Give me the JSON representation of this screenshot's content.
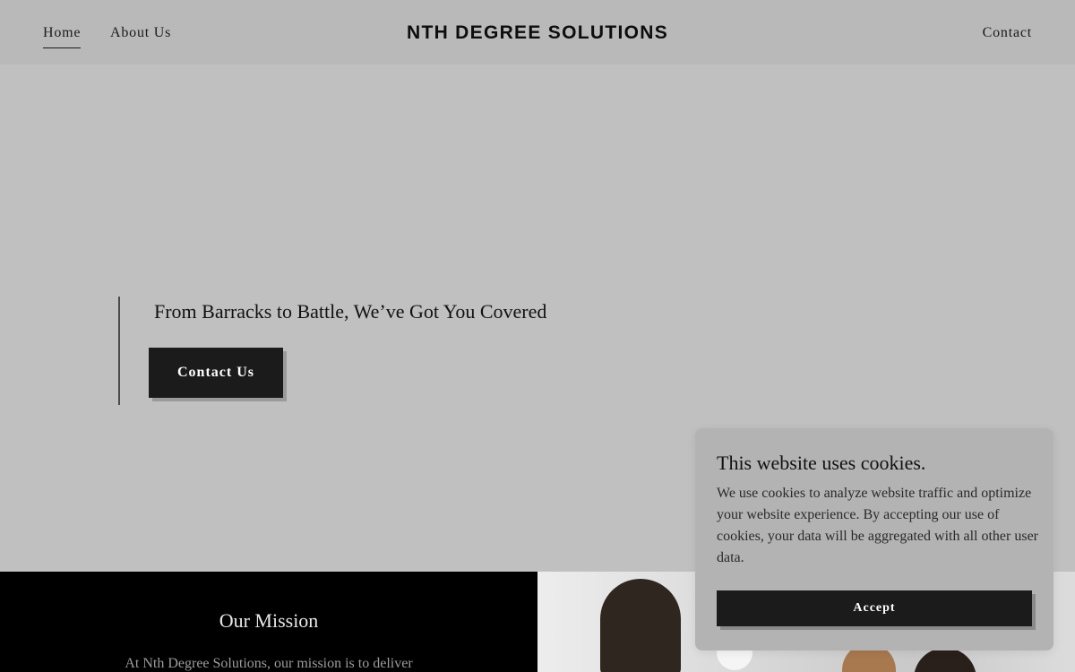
{
  "header": {
    "nav_home": "Home",
    "nav_about": "About Us",
    "brand": "NTH DEGREE SOLUTIONS",
    "nav_contact": "Contact"
  },
  "hero": {
    "tagline": "From Barracks to Battle, We’ve Got You Covered",
    "cta_label": "Contact Us"
  },
  "mission": {
    "title": "Our Mission",
    "text": "At Nth Degree Solutions, our mission is to deliver"
  },
  "cookie_banner": {
    "title": "This website uses cookies.",
    "body": "We use cookies to analyze website traffic and optimize your website experience. By accepting our use of cookies, your data will be aggregated with all other user data.",
    "accept_label": "Accept"
  },
  "colors": {
    "header_bg": "#b9b9b9",
    "hero_bg": "#c0c0c0",
    "button_bg": "#1b1b1b",
    "mission_bg": "#000000"
  }
}
